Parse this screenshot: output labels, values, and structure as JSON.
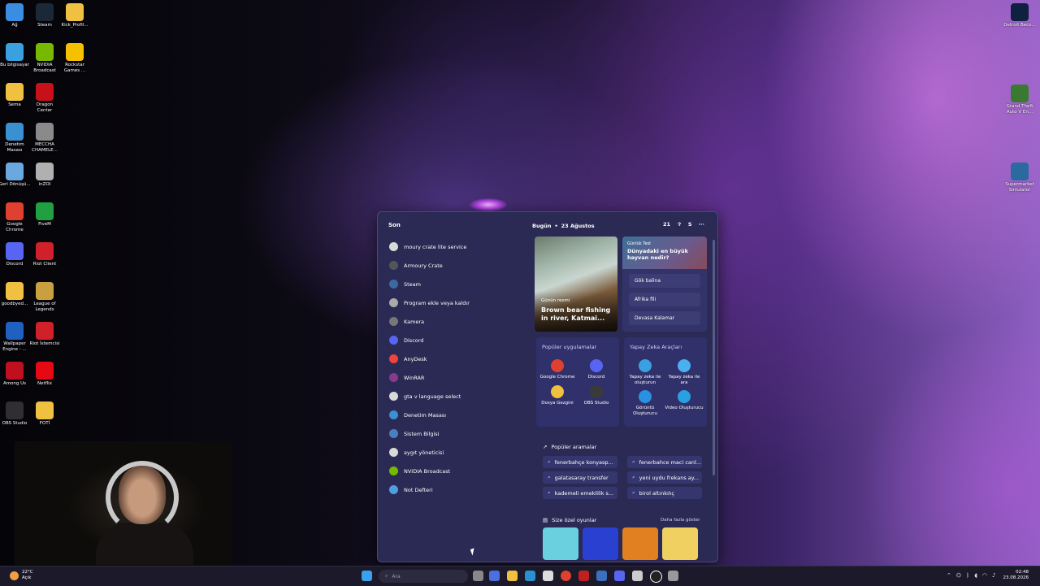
{
  "desktop": {
    "left_icons": [
      {
        "label": "Ağ",
        "icon": "network-icon",
        "color": "#3a8de0"
      },
      {
        "label": "Steam",
        "icon": "steam-icon",
        "color": "#1b2838"
      },
      {
        "label": "Kick_Profil...",
        "icon": "folder-icon",
        "color": "#f0c040"
      },
      {
        "label": "Bu bilgisayar",
        "icon": "computer-icon",
        "color": "#3aa0e0"
      },
      {
        "label": "NVIDIA Broadcast",
        "icon": "nvidia-icon",
        "color": "#76b900"
      },
      {
        "label": "Rockstar Games ...",
        "icon": "rockstar-icon",
        "color": "#f5c000"
      },
      {
        "label": "Sema",
        "icon": "folder-icon",
        "color": "#f0c040"
      },
      {
        "label": "Dragon Center",
        "icon": "dragon-center-icon",
        "color": "#c8101a"
      },
      {
        "label": "Denetim Masası",
        "icon": "control-panel-icon",
        "color": "#3a90d0"
      },
      {
        "label": "MECCHA CHAMELE...",
        "icon": "game-icon",
        "color": "#8a8a8a"
      },
      {
        "label": "Geri Dönüşü...",
        "icon": "recycle-bin-icon",
        "color": "#6aa8e0"
      },
      {
        "label": "inZOI",
        "icon": "inzoi-icon",
        "color": "#b0b0b0"
      },
      {
        "label": "Google Chrome",
        "icon": "chrome-icon",
        "color": "#e04030"
      },
      {
        "label": "FiveM",
        "icon": "fivem-icon",
        "color": "#20a040"
      },
      {
        "label": "Discord",
        "icon": "discord-icon",
        "color": "#5865f2"
      },
      {
        "label": "Riot Client",
        "icon": "riot-icon",
        "color": "#d0202a"
      },
      {
        "label": "goodbyed...",
        "icon": "folder-icon",
        "color": "#f0c040"
      },
      {
        "label": "League of Legends",
        "icon": "lol-icon",
        "color": "#c8a040"
      },
      {
        "label": "Wallpaper Engine - ...",
        "icon": "wallpaper-engine-icon",
        "color": "#2060c0"
      },
      {
        "label": "Riot İstemcisi",
        "icon": "riot-icon",
        "color": "#d0202a"
      },
      {
        "label": "Among Us",
        "icon": "among-us-icon",
        "color": "#c01020"
      },
      {
        "label": "Netflix",
        "icon": "netflix-icon",
        "color": "#e50914"
      },
      {
        "label": "OBS Studio",
        "icon": "obs-icon",
        "color": "#302e31"
      },
      {
        "label": "FOTİ",
        "icon": "folder-icon",
        "color": "#f0c040"
      }
    ],
    "right_icons": [
      {
        "label": "Detroit Beco...",
        "icon": "detroit-icon",
        "color": "#102040"
      },
      {
        "label": "Grand Theft Auto V En...",
        "icon": "gta-icon",
        "color": "#3a7a30"
      },
      {
        "label": "Supermarket Simulator",
        "icon": "supermarket-icon",
        "color": "#2a6aa0"
      }
    ]
  },
  "start_menu": {
    "recent_title": "Son",
    "recent": [
      {
        "label": "moury crate lite service",
        "icon": "search-icon",
        "color": "#d9d9d9"
      },
      {
        "label": "Armoury Crate",
        "icon": "armoury-crate-icon",
        "color": "#555555"
      },
      {
        "label": "Steam",
        "icon": "steam-icon",
        "color": "#3c6aa0"
      },
      {
        "label": "Program ekle veya kaldır",
        "icon": "apps-settings-icon",
        "color": "#aaaaaa"
      },
      {
        "label": "Kamera",
        "icon": "camera-icon",
        "color": "#777777"
      },
      {
        "label": "Discord",
        "icon": "discord-icon",
        "color": "#5865f2"
      },
      {
        "label": "AnyDesk",
        "icon": "anydesk-icon",
        "color": "#ef443b"
      },
      {
        "label": "WinRAR",
        "icon": "winrar-icon",
        "color": "#8a3a8a"
      },
      {
        "label": "gta v language select",
        "icon": "search-icon",
        "color": "#d9d9d9"
      },
      {
        "label": "Denetim Masası",
        "icon": "control-panel-icon",
        "color": "#3a90d0"
      },
      {
        "label": "Sistem Bilgisi",
        "icon": "system-info-icon",
        "color": "#4a80c0"
      },
      {
        "label": "aygıt yöneticisi",
        "icon": "search-icon",
        "color": "#d9d9d9"
      },
      {
        "label": "NVIDIA Broadcast",
        "icon": "nvidia-icon",
        "color": "#76b900"
      },
      {
        "label": "Not Defteri",
        "icon": "notepad-icon",
        "color": "#4aa0e0"
      }
    ],
    "widgets": {
      "header_today": "Bugün",
      "header_date": "23 Ağustos",
      "header_temp": "21",
      "header_s": "S",
      "header_more": "···",
      "news": {
        "kicker": "Günün resmi",
        "title": "Brown bear fishing in river, Katmai..."
      },
      "quiz": {
        "kicker": "Günlük Test",
        "question": "Dünyadaki en büyük hayvan nedir?",
        "options": [
          "Gök balina",
          "Afrika fili",
          "Devasa Kalamar"
        ]
      },
      "popular_apps_title": "Popüler uygulamalar",
      "popular_apps": [
        {
          "label": "Google Chrome",
          "icon": "chrome-icon",
          "color": "#e04030"
        },
        {
          "label": "Discord",
          "icon": "discord-icon",
          "color": "#5865f2"
        },
        {
          "label": "Dosya Gezgini",
          "icon": "file-explorer-icon",
          "color": "#f0c040"
        },
        {
          "label": "OBS Studio",
          "icon": "obs-icon",
          "color": "#3a3a3a"
        }
      ],
      "ai_tools_title": "Yapay Zeka Araçları",
      "ai_tools": [
        {
          "label": "Yapay zeka ile oluşturun",
          "icon": "ai-create-icon",
          "color": "#3aa0e0"
        },
        {
          "label": "Yapay zeka ile ara",
          "icon": "ai-search-icon",
          "color": "#4ab0f0"
        },
        {
          "label": "Görüntü Oluşturucu",
          "icon": "image-creator-icon",
          "color": "#2a90e0"
        },
        {
          "label": "Video Oluşturucu",
          "icon": "video-creator-icon",
          "color": "#2aa0e0"
        }
      ],
      "popular_searches_title": "Popüler aramalar",
      "popular_searches": [
        "fenerbahçe konyasp...",
        "fenerbahce maci canl...",
        "galatasaray transfer",
        "yeni uydu frekans ay...",
        "kademeli emeklilik s...",
        "birol altınkılıç"
      ],
      "games_title": "Size özel oyunlar",
      "games_more": "Daha fazla göster",
      "games": [
        {
          "icon": "game-tile-1-icon",
          "color": "#6ad0e0"
        },
        {
          "icon": "game-tile-2-icon",
          "color": "#2a40d0"
        },
        {
          "icon": "cut-the-rope-icon",
          "color": "#e08020"
        },
        {
          "icon": "game-tile-4-icon",
          "color": "#f0d060"
        }
      ]
    }
  },
  "taskbar": {
    "weather_temp": "22°C",
    "weather_desc": "Açık",
    "search_placeholder": "Ara",
    "time": "02:48",
    "date": "23.08.2026"
  }
}
